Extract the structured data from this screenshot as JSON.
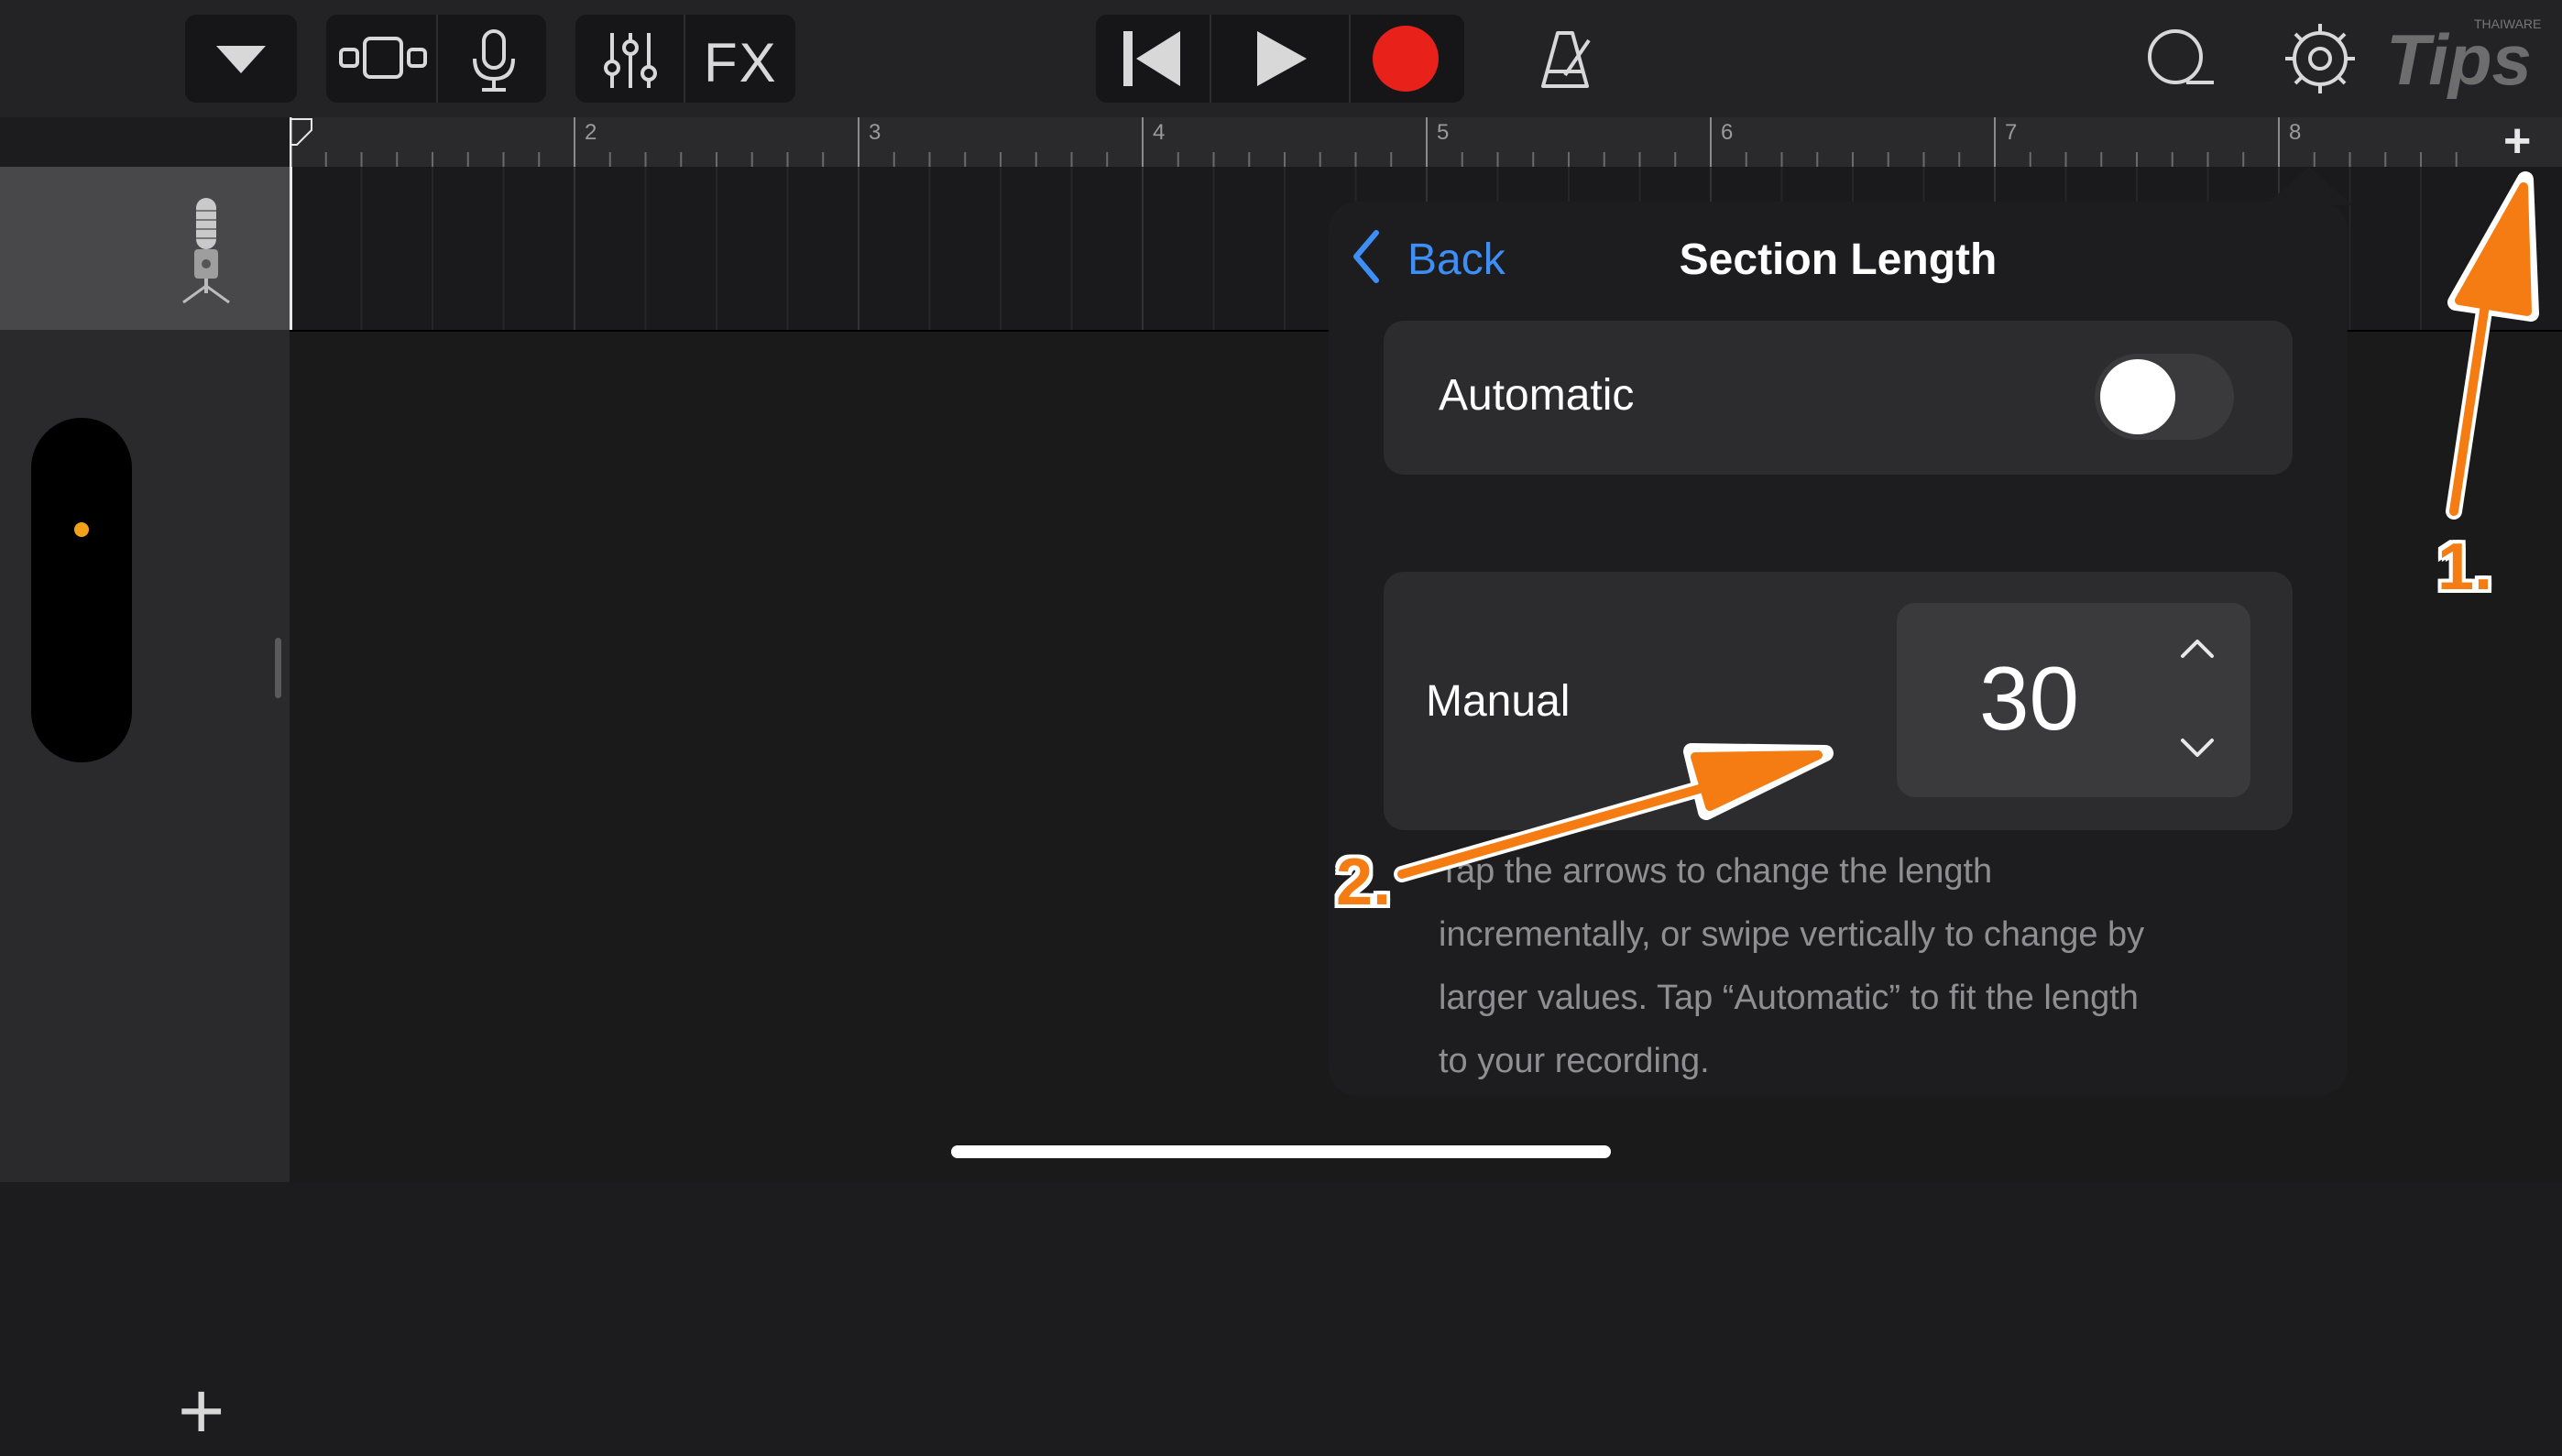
{
  "toolbar": {
    "browser_icon": "triangle-down-icon",
    "tracks_view_icon": "tracks-view-icon",
    "mic_icon": "microphone-icon",
    "mixer_icon": "sliders-icon",
    "fx_label": "FX",
    "rewind_icon": "skip-back-icon",
    "play_icon": "play-icon",
    "record_icon": "record-icon",
    "metronome_icon": "metronome-icon",
    "loop_icon": "loop-icon",
    "settings_icon": "gear-icon",
    "record_color": "#e8221b"
  },
  "watermark": {
    "small": "THAIWARE",
    "brand": "Tips"
  },
  "ruler": {
    "bar_numbers": [
      "2",
      "3",
      "4",
      "5",
      "6",
      "7",
      "8"
    ],
    "add_section": "+"
  },
  "track": {
    "instrument_icon": "studio-microphone-icon"
  },
  "left_panel": {
    "add_track": "+"
  },
  "popover": {
    "back_label": "Back",
    "title": "Section Length",
    "automatic_label": "Automatic",
    "automatic_on": false,
    "manual_label": "Manual",
    "manual_value": "30",
    "description": [
      "Tap the arrows to change the length",
      "incrementally, or swipe vertically to change by",
      "larger values. Tap “Automatic” to fit the length",
      "to your recording."
    ],
    "accent_color": "#3d8ef5"
  },
  "annotations": {
    "step1": "1.",
    "step2": "2.",
    "arrow_color": "#f47c12"
  }
}
